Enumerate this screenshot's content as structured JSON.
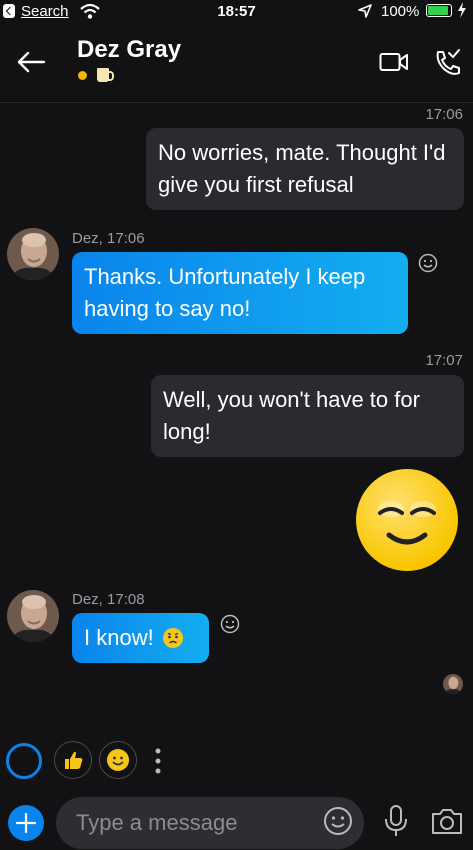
{
  "status_bar": {
    "back_app": "Search",
    "time": "18:57",
    "battery": "100%"
  },
  "header": {
    "contact_name": "Dez Gray",
    "presence_color": "#f2b700"
  },
  "messages": [
    {
      "direction": "out",
      "time": "17:06",
      "text": "No worries, mate. Thought I'd give you first refusal"
    },
    {
      "direction": "in",
      "sender_line": "Dez, 17:06",
      "text": "Thanks. Unfortunately I keep having to say no!"
    },
    {
      "direction": "out",
      "time": "17:07",
      "text": "Well, you won't have to for long!"
    },
    {
      "direction": "out",
      "type": "emoticon",
      "icon": "blissful-smile-emoticon"
    },
    {
      "direction": "in",
      "sender_line": "Dez, 17:08",
      "text": "I know!",
      "icon": "worried-emoticon"
    }
  ],
  "quick_reactions": [
    "thumbs-up-icon",
    "smile-icon"
  ],
  "composer": {
    "placeholder": "Type a message"
  },
  "colors": {
    "accent": "#0a84ec",
    "background": "#121214",
    "outgoing_bubble": "#2b2b2f"
  }
}
